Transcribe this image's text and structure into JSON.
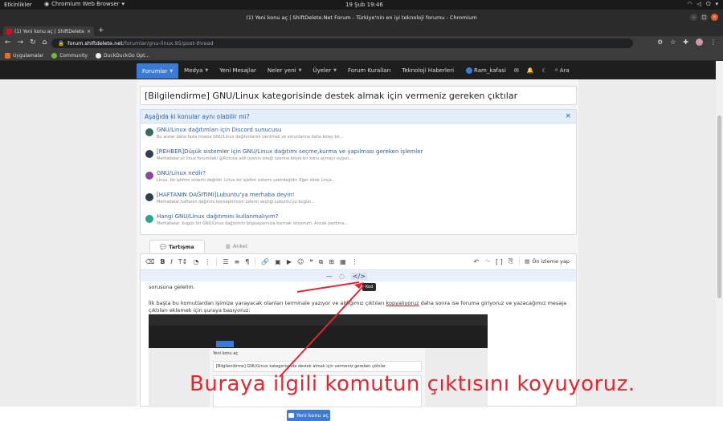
{
  "os_bar": {
    "activities": "Etkinlikler",
    "app_name": "Chromium Web Browser",
    "clock": "19 Şub  19:46"
  },
  "window": {
    "title": "(1) Yeni konu aç | ShiftDelete.Net Forum - Türkiye'nin en iyi teknoloji forumu - Chromium"
  },
  "browser": {
    "tab_label": "(1) Yeni konu aç | ShiftDelete",
    "url_domain": "forum.shiftdelete.net",
    "url_path": "/forumlar/gnu-linux.95/post-thread",
    "bookmarks": [
      "Uygulamalar",
      "Community",
      "DuckDuckGo Opt..."
    ]
  },
  "site_nav": {
    "items": [
      {
        "label": "Forumlar",
        "dropdown": true
      },
      {
        "label": "Medya",
        "dropdown": true
      },
      {
        "label": "Yeni Mesajlar",
        "dropdown": false
      },
      {
        "label": "Neler yeni",
        "dropdown": true
      },
      {
        "label": "Üyeler",
        "dropdown": true
      },
      {
        "label": "Forum Kuralları",
        "dropdown": false
      },
      {
        "label": "Teknoloji Haberleri",
        "dropdown": false
      }
    ],
    "username": "Ram_kafasi",
    "search_label": "Ara"
  },
  "thread_title": "[Bilgilendirme] GNU/Linux kategorisinde destek almak için vermeniz gereken çıktılar",
  "similar": {
    "heading": "Aşağıda ki konular aynı olabilir mi?",
    "threads": [
      {
        "title": "GNU/Linux dağıtımları için Discord sunucusu",
        "snippet": "Bu aralar daha fazla insana GNU/Linux dağıtımlarını tanıtmak ve sorunlarına daha kolay bir...",
        "color": "#3a6a5a"
      },
      {
        "title": "[REHBER]Düşük sistemler için GNU/Linux dağıtımı seçme,kurma ve yapılması gereken işlemler",
        "snippet": "Merhabalar,sc linux forumdaki @Richive adlı üyenin isteği üzerine böyle bir konu açmayı uygun...",
        "color": "#2f3f4f"
      },
      {
        "title": "GNU/Linux nedir?",
        "snippet": "Linux, bir işletim sistemi değildir. Linux bir işletim sistemi çekirdeğidir. Eğer direk Linux...",
        "color": "#8a4a9a"
      },
      {
        "title": "[HAFTANIN DAĞITIMI]Lubuntu'ya merhaba deyin!",
        "snippet": "Merhabalar,haftanın dağıtımı konseptimizin üzlerin seçtiği Lubuntu'yu bugün...",
        "color": "#2f3f4f"
      },
      {
        "title": "Hangi GNU/Linux dağıtımını kullanmalıyım?",
        "snippet": "Merhabalar, bugün bir GNU/Linux dağıtımını bilgisayarınıza kurmak istiyorum. Ancak yardıma...",
        "color": "#2aa58a"
      }
    ]
  },
  "editor_tabs": [
    "Tartışma",
    "Anket"
  ],
  "editor": {
    "preview_label": "Ön izleme yap",
    "tooltip": "Kod",
    "text_line1": "sorusuna gelelim.",
    "text_p2_before": "İlk başta bu komutlardan işimize yarayacak olanları terminale yazıyor ve aldığımız çıktıları ",
    "text_p2_link": "kopyalıyoruz",
    "text_p2_after": " daha sonra ise foruma giriyoruz ve yazacağımız mesaja çıktıları eklemek için şuraya basıyoruz:",
    "shot_heading": "Yeni konu aç",
    "shot_title": "[Bilgilendirme] GNU/Linux kategorisinde destek almak için vermeniz gereken çıktılar"
  },
  "post_button": "Yeni konu aç",
  "annotation": "Buraya ilgili komutun çıktısını koyuyoruz.",
  "colors": {
    "accent": "#3a7bd5",
    "annotation": "#e6262f"
  }
}
